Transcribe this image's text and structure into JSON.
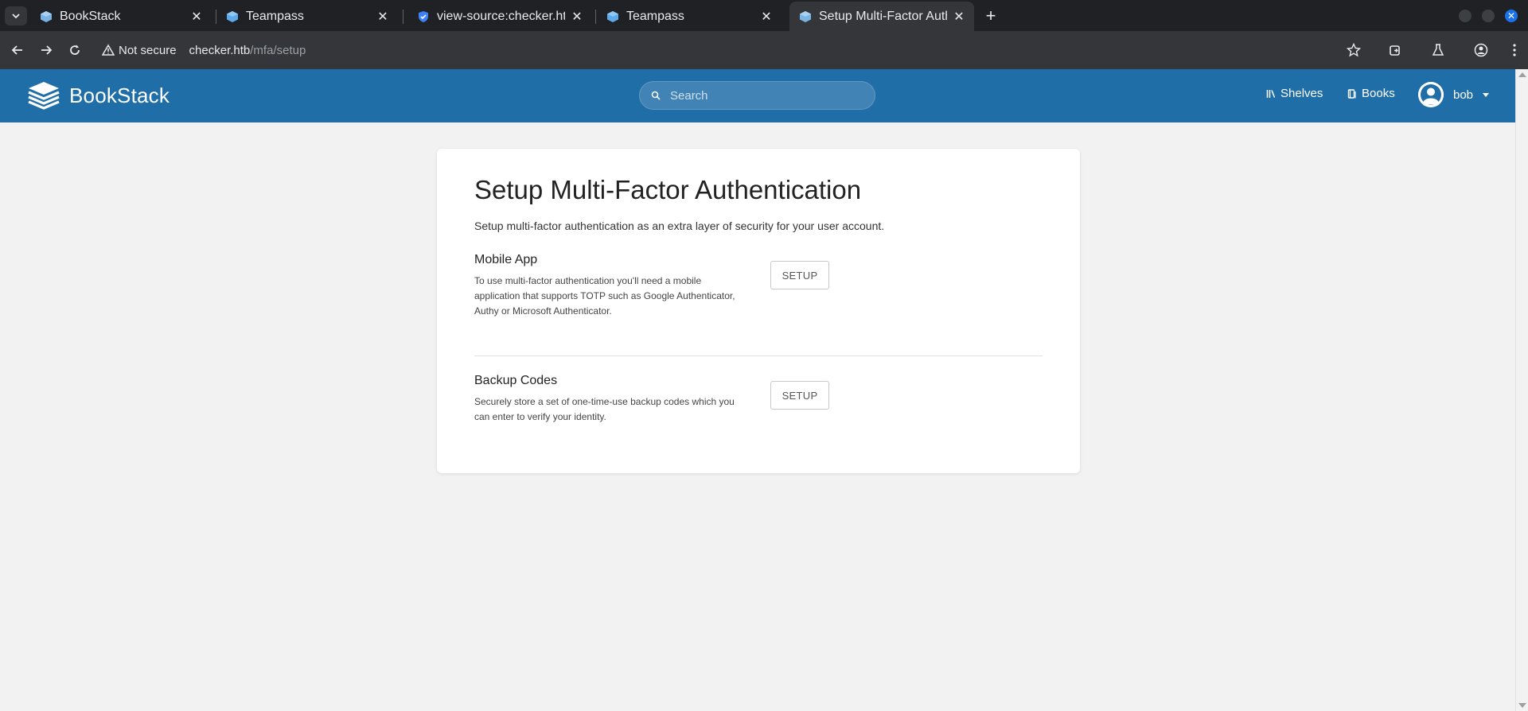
{
  "browser": {
    "tabs": [
      {
        "title": "BookStack",
        "icon": "bookstack-favicon",
        "active": false
      },
      {
        "title": "Teampass",
        "icon": "teampass-favicon",
        "active": false
      },
      {
        "title": "view-source:checker.htb",
        "icon": "shield-favicon",
        "active": false
      },
      {
        "title": "Teampass",
        "icon": "teampass-favicon",
        "active": false
      },
      {
        "title": "Setup Multi-Factor Authe",
        "icon": "bookstack-favicon",
        "active": true
      }
    ],
    "security_label": "Not secure",
    "url_host": "checker.htb",
    "url_path": "/mfa/setup"
  },
  "header": {
    "app_name": "BookStack",
    "search_placeholder": "Search",
    "nav": {
      "shelves": "Shelves",
      "books": "Books"
    },
    "user_name": "bob"
  },
  "page": {
    "title": "Setup Multi-Factor Authentication",
    "intro": "Setup multi-factor authentication as an extra layer of security for your user account.",
    "methods": [
      {
        "title": "Mobile App",
        "description": "To use multi-factor authentication you'll need a mobile application that supports TOTP such as Google Authenticator, Authy or Microsoft Authenticator.",
        "button": "SETUP"
      },
      {
        "title": "Backup Codes",
        "description": "Securely store a set of one-time-use backup codes which you can enter to verify your identity.",
        "button": "SETUP"
      }
    ]
  },
  "colors": {
    "header": "#206ea7",
    "page_background": "#f2f2f2",
    "browser_dark": "#202124",
    "browser_toolbar": "#35363a"
  }
}
